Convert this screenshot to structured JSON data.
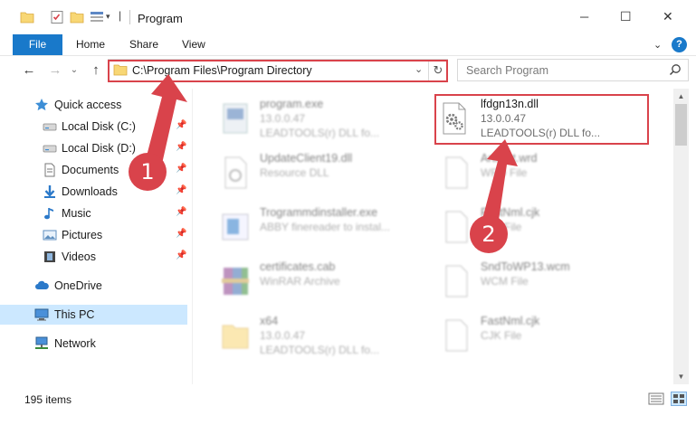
{
  "window": {
    "title": "Program",
    "controls": {
      "minimize": "─",
      "maximize": "☐",
      "close": "✕"
    }
  },
  "ribbon": {
    "tabs": [
      "File",
      "Home",
      "Share",
      "View"
    ],
    "help": "?",
    "expand": "⌄"
  },
  "nav": {
    "back": "←",
    "forward": "→",
    "recent": "⌄",
    "up": "↑",
    "address": "C:\\Program Files\\Program Directory",
    "address_chevron": "⌄",
    "refresh": "↻",
    "search_placeholder": "Search Program"
  },
  "sidebar": {
    "items": [
      {
        "label": "Quick access",
        "icon": "star-icon"
      },
      {
        "label": "Local Disk (C:)",
        "icon": "drive-icon",
        "pinned": true
      },
      {
        "label": "Local Disk (D:)",
        "icon": "drive-icon",
        "pinned": true
      },
      {
        "label": "Documents",
        "icon": "documents-icon",
        "pinned": true
      },
      {
        "label": "Downloads",
        "icon": "downloads-icon",
        "pinned": true
      },
      {
        "label": "Music",
        "icon": "music-icon",
        "pinned": true
      },
      {
        "label": "Pictures",
        "icon": "pictures-icon",
        "pinned": true
      },
      {
        "label": "Videos",
        "icon": "videos-icon",
        "pinned": true
      },
      {
        "label": "OneDrive",
        "icon": "cloud-icon"
      },
      {
        "label": "This PC",
        "icon": "computer-icon",
        "selected": true
      },
      {
        "label": "Network",
        "icon": "network-icon"
      }
    ],
    "pin_glyph": "📌"
  },
  "files": {
    "left": [
      {
        "name": "program.exe",
        "line1": "13.0.0.47",
        "line2": "LEADTOOLS(r) DLL fo..."
      },
      {
        "name": "UpdateClient19.dll",
        "line1": "Resource DLL",
        "line2": ""
      },
      {
        "name": "Trogrammdinstaller.exe",
        "line1": "ABBY finereader to instal...",
        "line2": ""
      },
      {
        "name": "certificates.cab",
        "line1": "WinRAR Archive",
        "line2": ""
      },
      {
        "name": "x64",
        "line1": "13.0.0.47",
        "line2": "LEADTOOLS(r) DLL fo..."
      }
    ],
    "right": [
      {
        "name": "lfdgn13n.dll",
        "line1": "13.0.0.47",
        "line2": "LEADTOOLS(r) DLL fo..."
      },
      {
        "name": "Artifact.wrd",
        "line1": "WRD File",
        "line2": ""
      },
      {
        "name": "FastNml.cjk",
        "line1": "CJK File",
        "line2": ""
      },
      {
        "name": "SndToWP13.wcm",
        "line1": "WCM File",
        "line2": ""
      },
      {
        "name": "FastNml.cjk",
        "line1": "CJK File",
        "line2": ""
      }
    ]
  },
  "status": {
    "items_count": "195 items"
  },
  "annotations": {
    "step1": "1",
    "step2": "2"
  },
  "colors": {
    "accent": "#1979ca",
    "highlight": "#d9434b",
    "selected": "#cce8ff"
  }
}
